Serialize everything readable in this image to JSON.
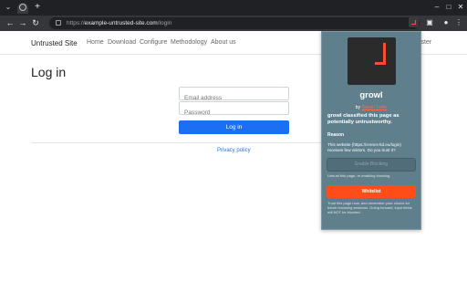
{
  "browser": {
    "url_prefix": "https://",
    "url_host": "example-untrusted-site.com",
    "url_path": "/login",
    "icons": {
      "tab_dropdown": "chevron-down-icon",
      "tab_favicon": "globe-icon",
      "new_tab": "plus-icon",
      "back": "arrow-left-icon",
      "forward": "arrow-right-icon",
      "reload": "reload-icon",
      "extensions": "puzzle-icon",
      "profile": "person-icon",
      "menu": "kebab-icon"
    }
  },
  "site": {
    "brand": "Untrusted Site",
    "nav": [
      "Home",
      "Download",
      "Configure",
      "Methodology",
      "About us"
    ],
    "register_partial": "gister",
    "heading": "Log in",
    "email_placeholder": "Email address",
    "password_placeholder": "Password",
    "login_button": "Log in",
    "privacy_link": "Privacy policy"
  },
  "growl": {
    "title": "growl",
    "by_prefix": "by",
    "author": "Daniel Tuller",
    "classification": "growl classified this page as potentially untrustworthy.",
    "reason_label": "Reason",
    "reason_text": "This website (https://crencs-ltd.eu/login) receives few visitors. Do you trust it?",
    "enable_button": "Enable Blocking",
    "enable_note": "Untrust this page, re-enabling blocking.",
    "whitelist_button": "Whitelist",
    "whitelist_note": "Trust this page now, and remember your choice for future browsing sessions. Going forward, input fields will NOT be blocked.",
    "accent": "#ff4d1a",
    "panel_color": "#5f7f8c"
  }
}
